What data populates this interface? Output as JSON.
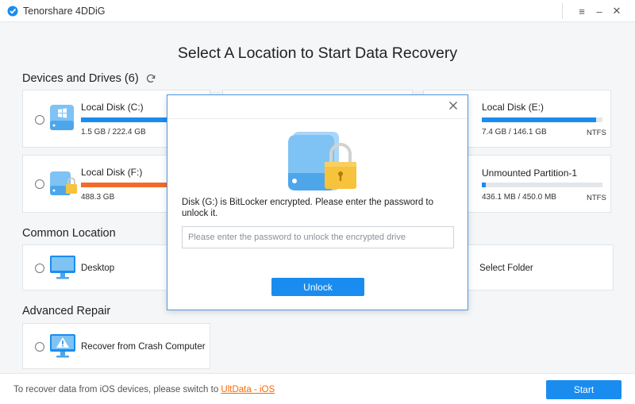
{
  "app": {
    "title": "Tenorshare 4DDiG"
  },
  "window_controls": {
    "menu": "≡",
    "minimize": "–",
    "close": "✕"
  },
  "main_title": "Select A Location to Start Data Recovery",
  "devices": {
    "title": "Devices and Drives (6)",
    "items": [
      {
        "name": "Local Disk (C:)",
        "size": "1.5 GB / 222.4 GB",
        "fs": "",
        "used_fraction": 0.9,
        "bar_color": "#1a8cf0"
      },
      {
        "name": "Local Disk (E:)",
        "size": "7.4 GB / 146.1 GB",
        "fs": "NTFS",
        "used_fraction": 0.95,
        "bar_color": "#1a8cf0"
      },
      {
        "name": "Local Disk (F:)",
        "size": "488.3 GB",
        "fs": "",
        "used_fraction": 1.0,
        "bar_color": "#f26b2a"
      },
      {
        "name": "Unmounted Partition-1",
        "size": "436.1 MB / 450.0 MB",
        "fs": "NTFS",
        "used_fraction": 0.03,
        "bar_color": "#1a8cf0"
      }
    ]
  },
  "common_location": {
    "title": "Common Location",
    "desktop": "Desktop",
    "select_folder": "Select Folder"
  },
  "advanced_repair": {
    "title": "Advanced Repair",
    "crash": "Recover from Crash Computer"
  },
  "footer": {
    "text": "To recover data from iOS devices, please switch to ",
    "link": "UltData - iOS",
    "start": "Start"
  },
  "dialog": {
    "message": "Disk (G:) is BitLocker encrypted. Please enter the password to unlock it.",
    "placeholder": "Please enter the password to unlock the encrypted drive",
    "unlock": "Unlock"
  },
  "colors": {
    "accent": "#1a8cf0",
    "orange": "#f26b2a",
    "link": "#ff6a00"
  }
}
